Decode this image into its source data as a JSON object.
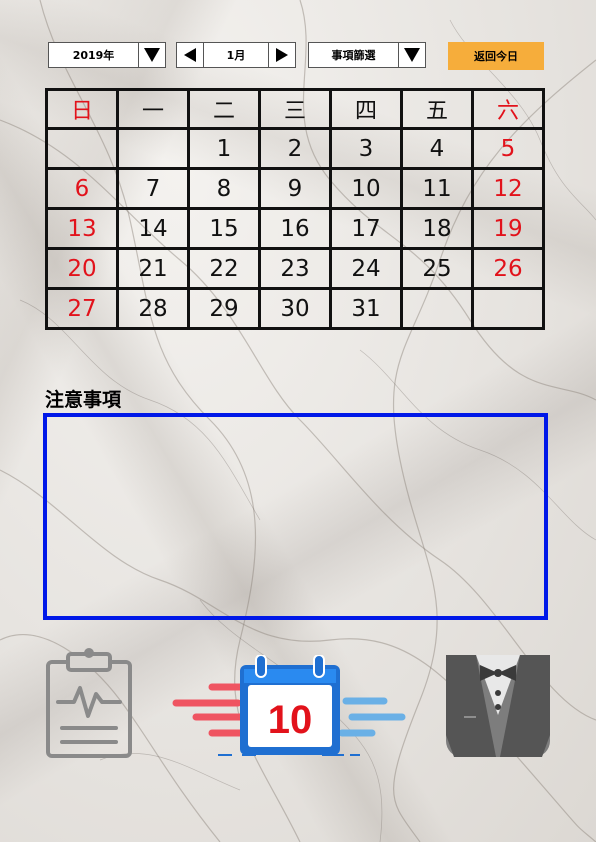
{
  "toolbar": {
    "year_value": "2019年",
    "month_value": "1月",
    "filter_label": "事項篩選",
    "today_label": "返回今日"
  },
  "calendar": {
    "weekdays": [
      "日",
      "一",
      "二",
      "三",
      "四",
      "五",
      "六"
    ],
    "weeks": [
      [
        "",
        "",
        "1",
        "2",
        "3",
        "4",
        "5"
      ],
      [
        "6",
        "7",
        "8",
        "9",
        "10",
        "11",
        "12"
      ],
      [
        "13",
        "14",
        "15",
        "16",
        "17",
        "18",
        "19"
      ],
      [
        "20",
        "21",
        "22",
        "23",
        "24",
        "25",
        "26"
      ],
      [
        "27",
        "28",
        "29",
        "30",
        "31",
        "",
        ""
      ]
    ],
    "weekend_color": "#e2121b"
  },
  "notes": {
    "title": "注意事項"
  },
  "bottom_icons": {
    "left": "clipboard-health-icon",
    "center": "calendar-icon",
    "center_day": "10",
    "right": "tuxedo-icon"
  },
  "colors": {
    "today_button": "#f6ad3b",
    "notes_border": "#0018e8",
    "accent_red": "#e2121b",
    "calendar_blue": "#1f6fd1"
  }
}
